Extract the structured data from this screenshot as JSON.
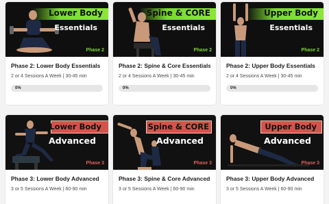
{
  "cards": [
    {
      "banner_line1": "Lower Body",
      "banner_line2": "Essentials",
      "phase_tag": "Phase 2",
      "title": "Phase 2: Lower Body Essentials",
      "subtitle": "2 or 4 Sessions A Week | 30-45 min",
      "progress_label": "0%",
      "progress": 0
    },
    {
      "banner_line1": "Spine & CORE",
      "banner_line2": "Essentials",
      "phase_tag": "Phase 2",
      "title": "Phase 2: Spine & Core Essentials",
      "subtitle": "2 or 4 Sessions A Week | 30-45 min",
      "progress_label": "0%",
      "progress": 0
    },
    {
      "banner_line1": "Upper Body",
      "banner_line2": "Essentials",
      "phase_tag": "Phase 2",
      "title": "Phase 2: Upper Body Essentials",
      "subtitle": "2 or 4 Sessions A Week | 30-45 min",
      "progress_label": "0%",
      "progress": 0
    },
    {
      "banner_line1": "Lower Body",
      "banner_line2": "Advanced",
      "phase_tag": "Phase 3",
      "title": "Phase 3: Lower Body Advanced",
      "subtitle": "3 or 5 Sessions A Week | 60-90 min"
    },
    {
      "banner_line1": "Spine & CORE",
      "banner_line2": "Advanced",
      "phase_tag": "Phase 3",
      "title": "Phase 3: Spine & Core Advanced",
      "subtitle": "3 or 5 Sessions A Week | 60-90 min"
    },
    {
      "banner_line1": "Upper Body",
      "banner_line2": "Advanced",
      "phase_tag": "Phase 3",
      "title": "Phase 3: Upper Body Advanced",
      "subtitle": "3 or 5 Sessions A Week | 60-90 min"
    }
  ],
  "colors": {
    "essentials_accent": "#8be63a",
    "advanced_accent": "#d2544b",
    "progress_track": "#e6e6e6",
    "page_bg": "#f3f3f3"
  }
}
